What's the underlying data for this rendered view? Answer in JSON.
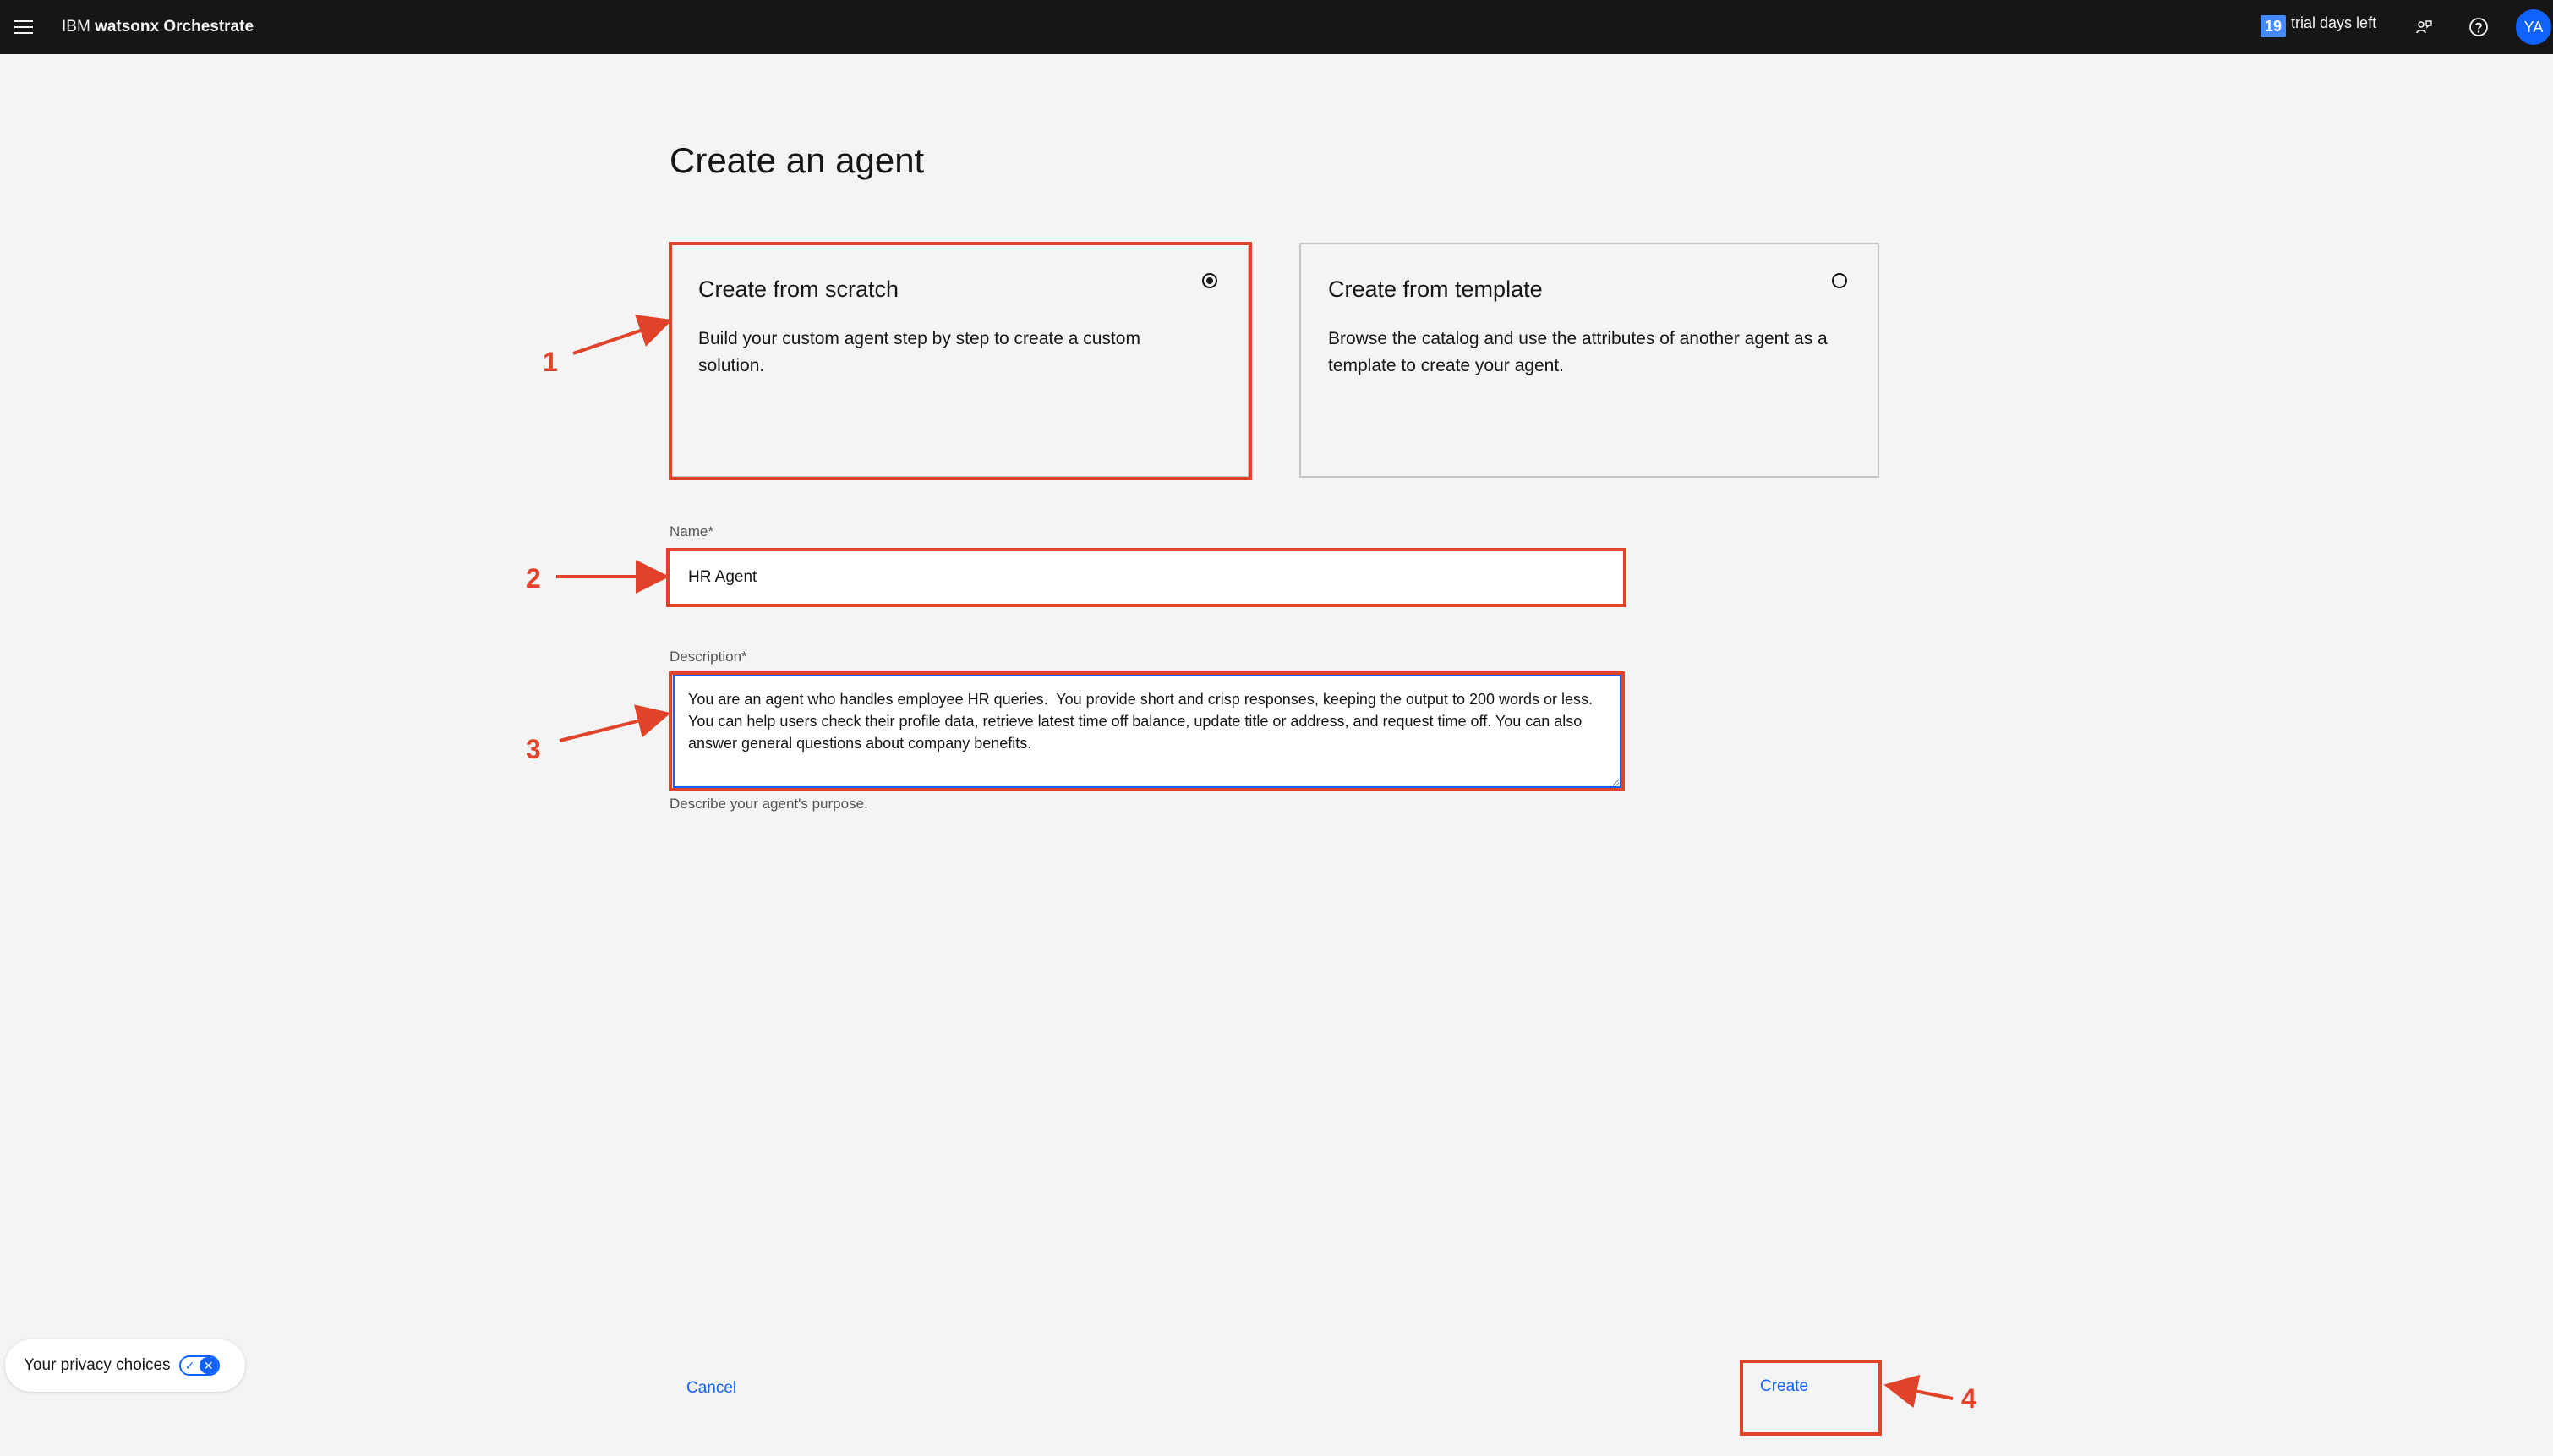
{
  "header": {
    "brand_prefix": "IBM ",
    "brand_product": "watsonx Orchestrate",
    "trial_days": "19",
    "trial_label": "trial days left",
    "avatar_initials": "YA",
    "icons": [
      "menu-icon",
      "switcher-icon",
      "help-icon"
    ]
  },
  "page": {
    "title": "Create an agent"
  },
  "options": [
    {
      "title": "Create from scratch",
      "description": "Build your custom agent step by step to create a custom solution.",
      "selected": true
    },
    {
      "title": "Create from template",
      "description": "Browse the catalog and use the attributes of another agent as a template to create your agent.",
      "selected": false
    }
  ],
  "form": {
    "name_label": "Name*",
    "name_value": "HR Agent",
    "description_label": "Description*",
    "description_value": "You are an agent who handles employee HR queries.  You provide short and crisp responses, keeping the output to 200 words or less.  You can help users check their profile data, retrieve latest time off balance, update title or address, and request time off. You can also answer general questions about company benefits.\n",
    "description_helper": "Describe your agent's purpose."
  },
  "footer": {
    "cancel_label": "Cancel",
    "create_label": "Create"
  },
  "privacy": {
    "label": "Your privacy choices",
    "toggle_on": "✓",
    "toggle_off": "✕"
  },
  "annotations": {
    "color": "#e0422a",
    "labels": [
      "1",
      "2",
      "3",
      "4"
    ]
  },
  "colors": {
    "header_bg": "#161616",
    "page_bg": "#f4f4f4",
    "link_blue": "#0f62fe",
    "trial_badge": "#4589ff"
  }
}
